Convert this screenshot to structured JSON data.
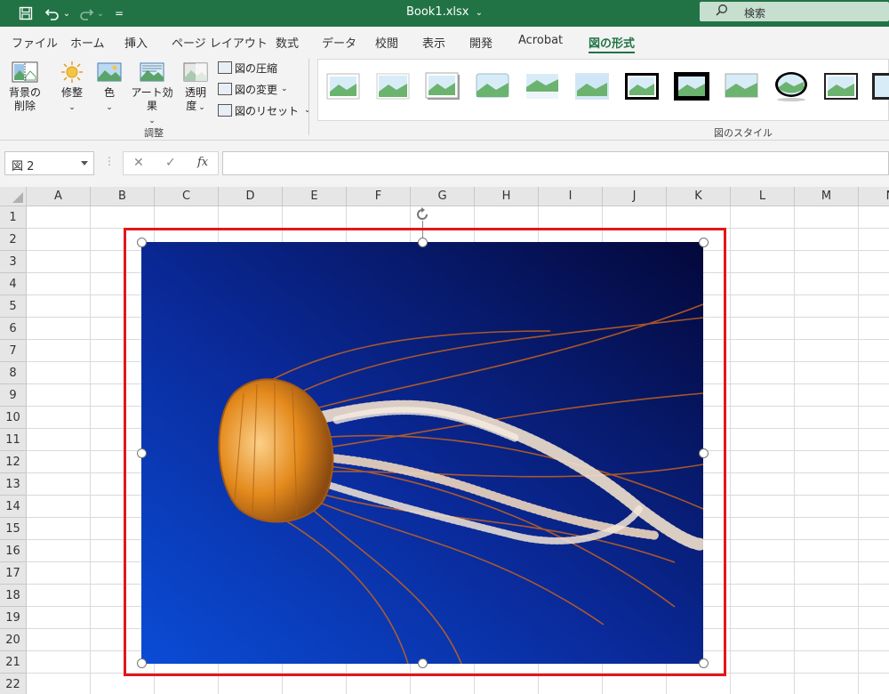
{
  "titlebar": {
    "filename": "Book1.xlsx",
    "filename_caret": "⌄",
    "search_placeholder": "検索",
    "undo_caret": "⌄",
    "redo_caret": "⌄",
    "customize_glyph": "="
  },
  "ribbon_tabs": [
    {
      "label": "ファイル",
      "active": false
    },
    {
      "label": "ホーム",
      "active": false
    },
    {
      "label": "挿入",
      "active": false
    },
    {
      "label": "ページ レイアウト",
      "active": false
    },
    {
      "label": "数式",
      "active": false
    },
    {
      "label": "データ",
      "active": false
    },
    {
      "label": "校閲",
      "active": false
    },
    {
      "label": "表示",
      "active": false
    },
    {
      "label": "開発",
      "active": false
    },
    {
      "label": "Acrobat",
      "active": false
    },
    {
      "label": "図の形式",
      "active": true
    }
  ],
  "ribbon": {
    "adjust": {
      "remove_bg_line1": "背景の",
      "remove_bg_line2": "削除",
      "corrections": "修整",
      "color": "色",
      "artistic": "アート効果",
      "transparency_line1": "透明",
      "transparency_line2": "度",
      "compress": "図の圧縮",
      "change_picture": "図の変更",
      "reset_picture": "図のリセット",
      "group_label": "調整"
    },
    "styles": {
      "group_label": "図のスタイル"
    }
  },
  "formula_bar": {
    "name_box": "図 2",
    "cancel": "✕",
    "enter": "✓",
    "fx": "fx",
    "value": ""
  },
  "columns": [
    "A",
    "B",
    "C",
    "D",
    "E",
    "F",
    "G",
    "H",
    "I",
    "J",
    "K",
    "L",
    "M",
    "N"
  ],
  "rows": [
    "1",
    "2",
    "3",
    "4",
    "5",
    "6",
    "7",
    "8",
    "9",
    "10",
    "11",
    "12",
    "13",
    "14",
    "15",
    "16",
    "17",
    "18",
    "19",
    "20",
    "21",
    "22"
  ],
  "colors": {
    "excel_green": "#217346",
    "selection_red": "#e3161b",
    "picture_deep_blue": "#04083a",
    "picture_bright_blue": "#0a4cd6",
    "jellyfish_orange": "#e48a1c"
  },
  "picture": {
    "subject": "jellyfish"
  }
}
